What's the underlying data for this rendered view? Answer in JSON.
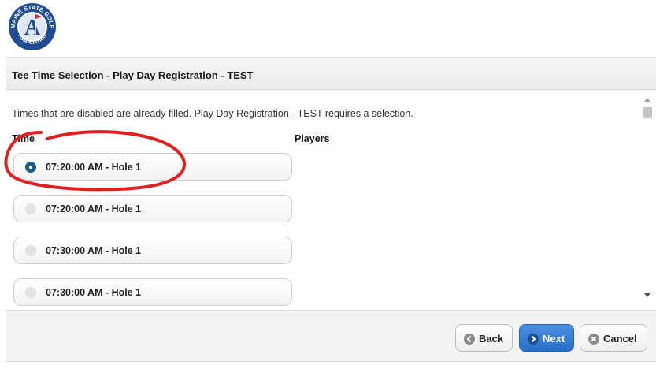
{
  "logo": {
    "ring_top_text": "MAINE STATE GOLF",
    "ring_bottom_text": "ASSOCIATION",
    "monogram": "A"
  },
  "dialog": {
    "title": "Tee Time Selection - Play Day Registration - TEST",
    "info_text": "Times that are disabled are already filled. Play Day Registration - TEST requires a selection.",
    "columns": {
      "time": "Time",
      "players": "Players"
    },
    "tee_times": [
      {
        "label": "07:20:00 AM - Hole 1",
        "state": "selected"
      },
      {
        "label": "07:20:00 AM - Hole 1",
        "state": "disabled"
      },
      {
        "label": "07:30:00 AM - Hole 1",
        "state": "disabled"
      },
      {
        "label": "07:30:00 AM - Hole 1",
        "state": "disabled"
      }
    ]
  },
  "footer": {
    "back_label": "Back",
    "next_label": "Next",
    "cancel_label": "Cancel"
  },
  "icons": {
    "back": "chevron-left-circle-icon",
    "next": "chevron-right-circle-icon",
    "cancel": "x-circle-icon"
  },
  "colors": {
    "primary_button": "#2a6fc9",
    "selected_radio": "#1f5e85",
    "annotation": "#e02020",
    "logo_blue": "#1e4b93"
  }
}
